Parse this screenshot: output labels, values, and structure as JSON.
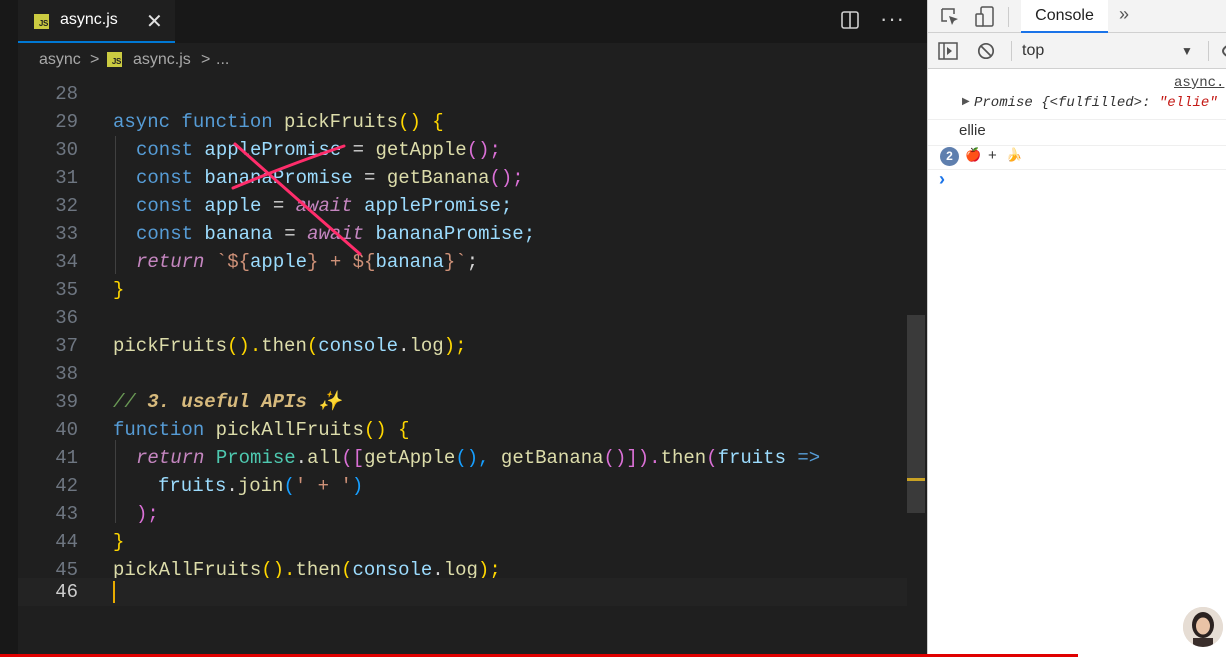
{
  "editor": {
    "tab": {
      "label": "async.js",
      "badge": "JS",
      "close": "✕"
    },
    "actions": {
      "more": "···"
    },
    "breadcrumb": {
      "folder": "async",
      "sep1": ">",
      "badge": "JS",
      "file": "async.js",
      "sep2": ">",
      "ellipsis": "..."
    },
    "line_numbers": [
      "28",
      "29",
      "30",
      "31",
      "32",
      "33",
      "34",
      "35",
      "36",
      "37",
      "38",
      "39",
      "40",
      "41",
      "42",
      "43",
      "44",
      "45",
      "46"
    ],
    "code": {
      "l29": {
        "kw": "async function ",
        "fn": "pickFruits",
        "p": "() ",
        "b": "{"
      },
      "l30": {
        "kw": "const ",
        "v": "applePromise",
        "op": " = ",
        "fn": "getApple",
        "p": "();"
      },
      "l31": {
        "kw": "const ",
        "v": "bananaPromise",
        "op": " = ",
        "fn": "getBanana",
        "p": "();"
      },
      "l32": {
        "kw": "const ",
        "v": "apple",
        "op": " = ",
        "aw": "await",
        "rest": " applePromise;"
      },
      "l33": {
        "kw": "const ",
        "v": "banana",
        "op": " = ",
        "aw": "await",
        "rest": " bananaPromise;"
      },
      "l34": {
        "ret": "return",
        "s1": " `${",
        "v1": "apple",
        "s2": "} + ${",
        "v2": "banana",
        "s3": "}`",
        "end": ";"
      },
      "l35": {
        "b": "}"
      },
      "l37": {
        "fn": "pickFruits",
        "p1": "().",
        "m": "then",
        "p2": "(",
        "v": "console",
        "dot": ".",
        "m2": "log",
        "p3": ");"
      },
      "l39": {
        "slash": "// ",
        "text": "3. useful APIs ✨"
      },
      "l40": {
        "kw": "function ",
        "fn": "pickAllFruits",
        "p": "() ",
        "b": "{"
      },
      "l41": {
        "ret": "return ",
        "cls": "Promise",
        "dot": ".",
        "m": "all",
        "p1": "([",
        "f1": "getApple",
        "p2": "(), ",
        "f2": "getBanana",
        "p3": "()]).",
        "m2": "then",
        "p4": "(",
        "v": "fruits",
        "arrow": " =>"
      },
      "l42": {
        "v": "fruits",
        "dot": ".",
        "m": "join",
        "p1": "(",
        "s": "' + '",
        "p2": ")"
      },
      "l43": {
        "p": ");"
      },
      "l44": {
        "b": "}"
      },
      "l45": {
        "fn": "pickAllFruits",
        "p1": "().",
        "m": "then",
        "p2": "(",
        "v": "console",
        "dot": ".",
        "m2": "log",
        "p3": ");"
      }
    }
  },
  "devtools": {
    "tabs": {
      "console": "Console",
      "more": "»"
    },
    "toolbar": {
      "context": "top",
      "arrow": "▼"
    },
    "messages": {
      "source_link": "async.",
      "promise_arrow": "▶",
      "promise_label": "Promise",
      "promise_state": " {<fulfilled>: ",
      "promise_value": "\"ellie\"",
      "log1": "ellie",
      "repeat_count": "2",
      "fruit_apple": "🍎",
      "plus": "+",
      "fruit_banana": "🍌",
      "prompt": "›"
    }
  },
  "colors": {
    "accent": "#0078d4",
    "js_badge": "#cbcb41",
    "cursor": "#e8ab00",
    "annotation": "#ff2d6b",
    "devtools_tab": "#1a73e8",
    "string": "#c41a16"
  }
}
